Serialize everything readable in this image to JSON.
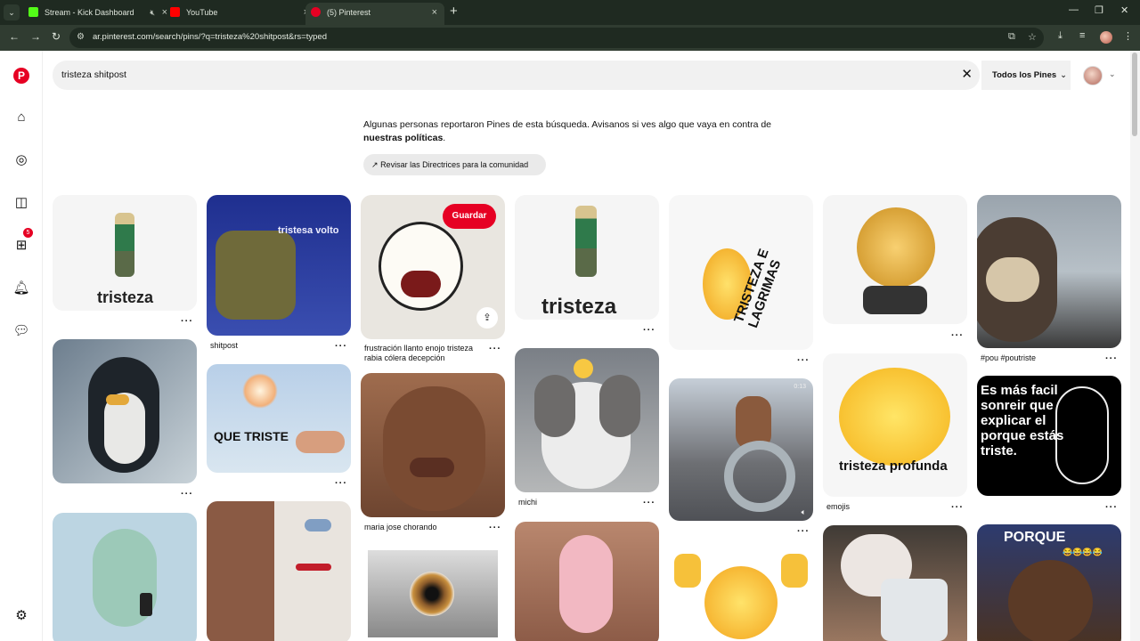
{
  "browser": {
    "tabs": [
      {
        "title": "Stream - Kick Dashboard",
        "active": false
      },
      {
        "title": "YouTube",
        "active": false
      },
      {
        "title": "(5) Pinterest",
        "active": true
      }
    ],
    "url": "ar.pinterest.com/search/pins/?q=tristeza%20shitpost&rs=typed"
  },
  "rail": {
    "notifications_count": "5"
  },
  "search": {
    "query": "tristeza shitpost",
    "filter_label": "Todos los Pines"
  },
  "notice": {
    "text": "Algunas personas reportaron Pines de esta búsqueda. Avisanos si ves algo que vaya en contra de",
    "link": "nuestras políticas",
    "suffix": ".",
    "button": "Revisar las Directrices para la comunidad"
  },
  "pins": {
    "save_label": "Guardar",
    "more_label": "···",
    "p1": {
      "overlay": "tristeza"
    },
    "p2": {
      "overlay": "tristesa volto",
      "caption": "shitpost"
    },
    "p3": {
      "caption": "frustración llanto enojo tristeza rabia cólera decepción"
    },
    "p4": {
      "overlay": "tristeza"
    },
    "p5": {
      "overlay": "TRISTEZA E LAGRIMAS"
    },
    "p7": {
      "caption": "#pou #poutriste"
    },
    "p9": {
      "overlay": "QUE TRISTE"
    },
    "p10": {
      "caption": "maria jose chorando"
    },
    "p11": {
      "caption": "michi"
    },
    "p12": {
      "overlay": "0:13"
    },
    "p13": {
      "overlay": "tristeza profunda",
      "caption": "emojis"
    },
    "p14": {
      "overlay": "Es más facil sonreir que explicar el porque estás triste."
    },
    "p20": {
      "overlay": "PORQUE"
    }
  }
}
